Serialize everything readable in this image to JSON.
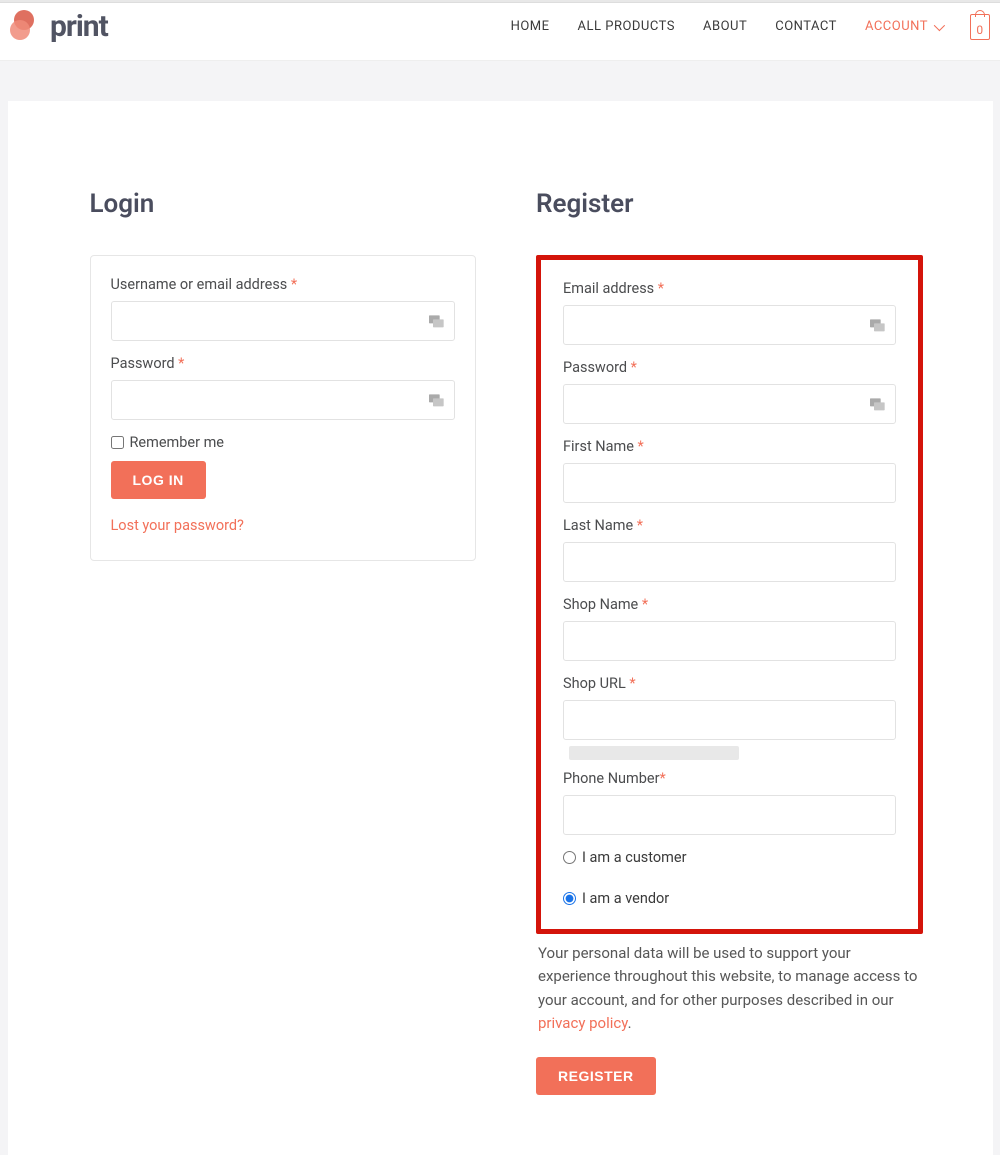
{
  "brand": {
    "name": "print"
  },
  "nav": {
    "home": "HOME",
    "products": "ALL PRODUCTS",
    "about": "ABOUT",
    "contact": "CONTACT",
    "account": "ACCOUNT",
    "cart_count": "0"
  },
  "login": {
    "title": "Login",
    "username_label": "Username or email address",
    "password_label": "Password",
    "remember_label": "Remember me",
    "submit_label": "LOG IN",
    "lost_label": "Lost your password?"
  },
  "register": {
    "title": "Register",
    "email_label": "Email address",
    "password_label": "Password",
    "first_name_label": "First Name",
    "last_name_label": "Last Name",
    "shop_name_label": "Shop Name",
    "shop_url_label": "Shop URL",
    "phone_label": "Phone Number",
    "role_customer_label": "I am a customer",
    "role_vendor_label": "I am a vendor",
    "privacy_text": "Your personal data will be used to support your experience throughout this website, to manage access to your account, and for other purposes described in our ",
    "privacy_link": "privacy policy",
    "privacy_suffix": ".",
    "submit_label": "REGISTER"
  },
  "asterisk": "*"
}
